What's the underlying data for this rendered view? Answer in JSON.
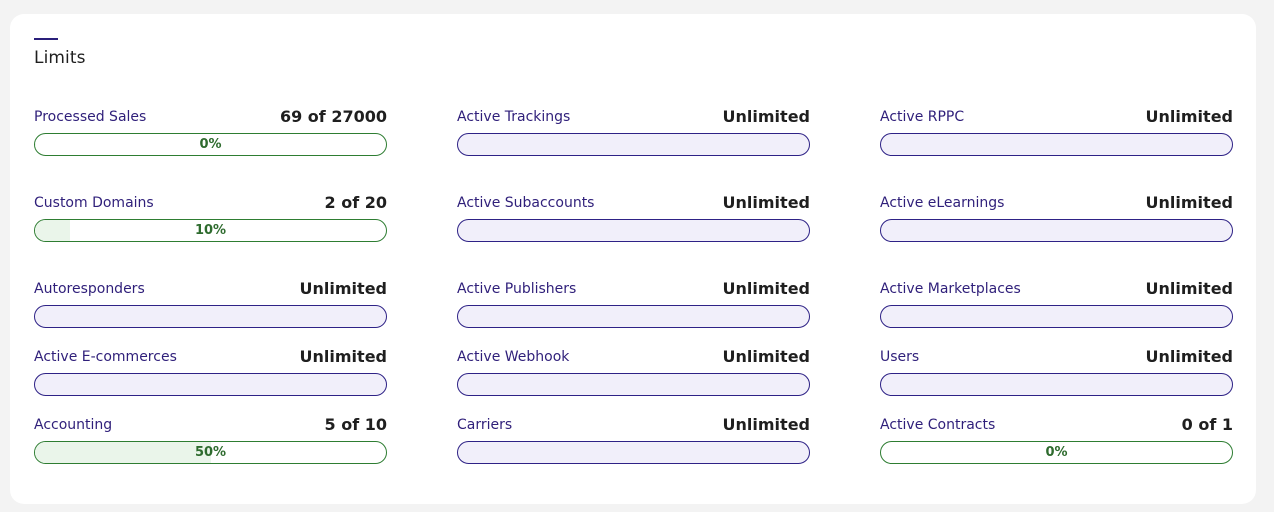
{
  "title": "Limits",
  "colors": {
    "accent": "#2a1f7a",
    "label": "#2f1f7a",
    "counted_border": "#2e7d32",
    "counted_fill": "#eaf5ea",
    "unlimited_bg": "#f1effa",
    "unlimited_border": "#2e2286"
  },
  "limits": [
    {
      "label": "Processed Sales",
      "value": "69 of 27000",
      "percent_text": "0%",
      "fill_percent": 0.26
    },
    {
      "label": "Active Trackings",
      "value": "Unlimited"
    },
    {
      "label": "Active RPPC",
      "value": "Unlimited"
    },
    {
      "label": "Custom Domains",
      "value": "2 of 20",
      "percent_text": "10%",
      "fill_percent": 10
    },
    {
      "label": "Active Subaccounts",
      "value": "Unlimited"
    },
    {
      "label": "Active eLearnings",
      "value": "Unlimited"
    },
    {
      "label": "Autoresponders",
      "value": "Unlimited"
    },
    {
      "label": "Active Publishers",
      "value": "Unlimited"
    },
    {
      "label": "Active Marketplaces",
      "value": "Unlimited"
    },
    {
      "label": "Active E-commerces",
      "value": "Unlimited"
    },
    {
      "label": "Active Webhook",
      "value": "Unlimited"
    },
    {
      "label": "Users",
      "value": "Unlimited"
    },
    {
      "label": "Accounting",
      "value": "5 of 10",
      "percent_text": "50%",
      "fill_percent": 50
    },
    {
      "label": "Carriers",
      "value": "Unlimited"
    },
    {
      "label": "Active Contracts",
      "value": "0 of 1",
      "percent_text": "0%",
      "fill_percent": 0
    }
  ]
}
